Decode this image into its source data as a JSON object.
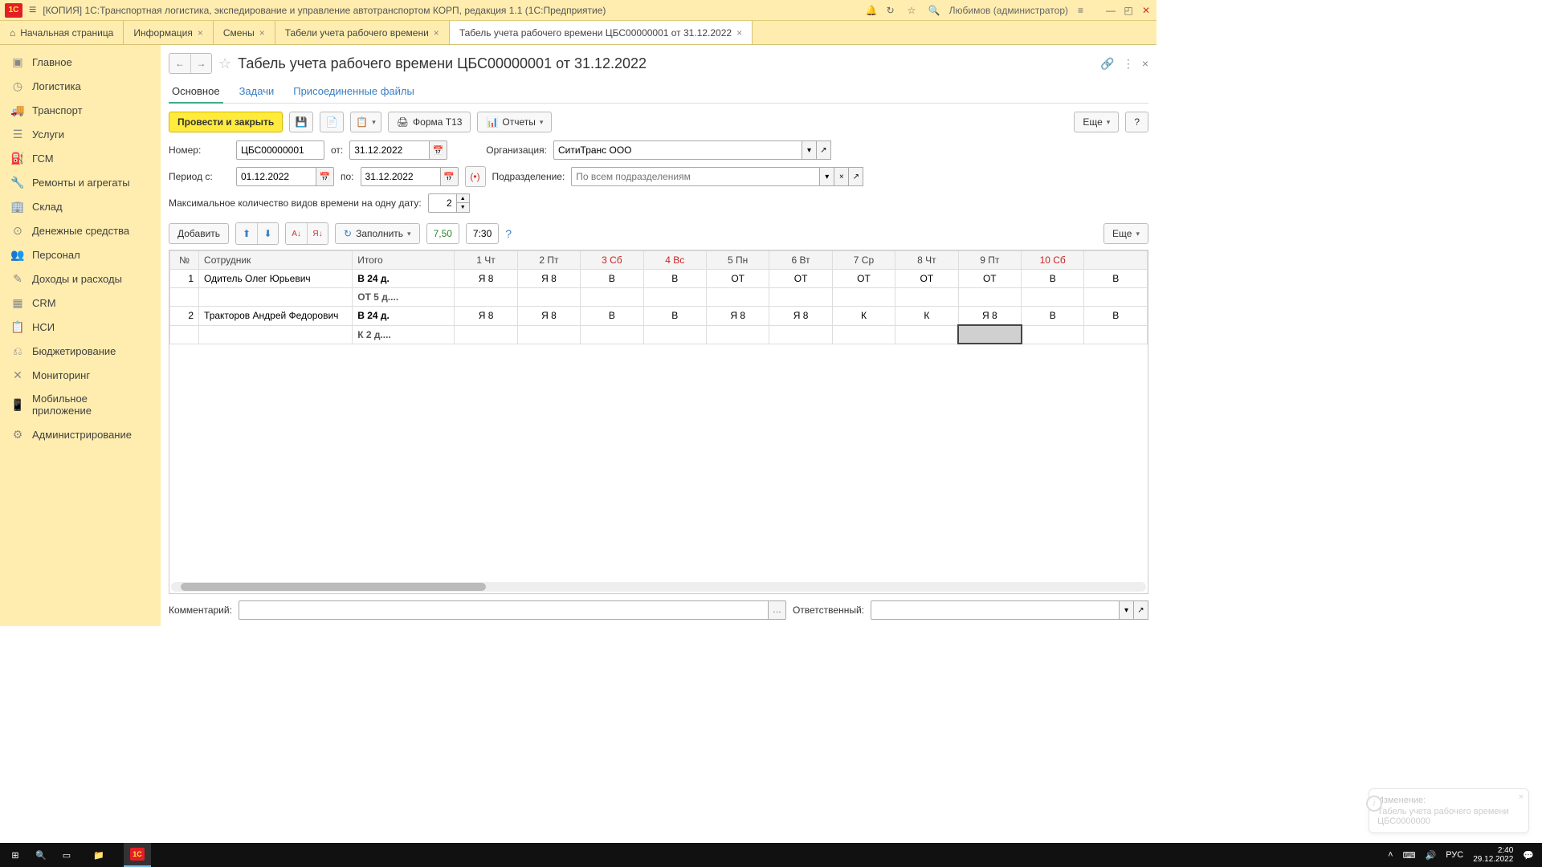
{
  "titlebar": {
    "title": "[КОПИЯ] 1С:Транспортная логистика, экспедирование и управление автотранспортом КОРП, редакция 1.1  (1С:Предприятие)",
    "user": "Любимов (администратор)"
  },
  "tabs": {
    "home": "Начальная страница",
    "items": [
      "Информация",
      "Смены",
      "Табели учета рабочего времени",
      "Табель учета рабочего времени ЦБС00000001 от 31.12.2022"
    ]
  },
  "sidebar": [
    {
      "icon": "▣",
      "label": "Главное"
    },
    {
      "icon": "◷",
      "label": "Логистика"
    },
    {
      "icon": "🚚",
      "label": "Транспорт"
    },
    {
      "icon": "☰",
      "label": "Услуги"
    },
    {
      "icon": "⛽",
      "label": "ГСМ"
    },
    {
      "icon": "🔧",
      "label": "Ремонты и агрегаты"
    },
    {
      "icon": "🏢",
      "label": "Склад"
    },
    {
      "icon": "⊙",
      "label": "Денежные средства"
    },
    {
      "icon": "👥",
      "label": "Персонал"
    },
    {
      "icon": "✎",
      "label": "Доходы и расходы"
    },
    {
      "icon": "▦",
      "label": "CRM"
    },
    {
      "icon": "📋",
      "label": "НСИ"
    },
    {
      "icon": "⎌",
      "label": "Бюджетирование"
    },
    {
      "icon": "✕",
      "label": "Мониторинг"
    },
    {
      "icon": "📱",
      "label": "Мобильное приложение"
    },
    {
      "icon": "⚙",
      "label": "Администрирование"
    }
  ],
  "page": {
    "title": "Табель учета рабочего времени ЦБС00000001 от 31.12.2022",
    "subtabs": {
      "main": "Основное",
      "tasks": "Задачи",
      "files": "Присоединенные файлы"
    }
  },
  "toolbar": {
    "post_close": "Провести и закрыть",
    "form_t13": "Форма Т13",
    "reports": "Отчеты",
    "more": "Еще",
    "help": "?"
  },
  "form": {
    "number_label": "Номер:",
    "number_value": "ЦБС00000001",
    "from_label": "от:",
    "from_value": "31.12.2022",
    "org_label": "Организация:",
    "org_value": "СитиТранс ООО",
    "period_from_label": "Период с:",
    "period_from_value": "01.12.2022",
    "period_to_label": "по:",
    "period_to_value": "31.12.2022",
    "dept_label": "Подразделение:",
    "dept_placeholder": "По всем подразделениям",
    "max_types_label": "Максимальное количество видов времени на одну дату:",
    "max_types_value": "2"
  },
  "table_toolbar": {
    "add": "Добавить",
    "fill": "Заполнить",
    "val1": "7,50",
    "val2": "7:30",
    "more": "Еще"
  },
  "table": {
    "headers": {
      "n": "№",
      "employee": "Сотрудник",
      "total": "Итого",
      "days": [
        {
          "label": "1 Чт",
          "weekend": false
        },
        {
          "label": "2 Пт",
          "weekend": false
        },
        {
          "label": "3 Сб",
          "weekend": true
        },
        {
          "label": "4 Вс",
          "weekend": true
        },
        {
          "label": "5 Пн",
          "weekend": false
        },
        {
          "label": "6 Вт",
          "weekend": false
        },
        {
          "label": "7 Ср",
          "weekend": false
        },
        {
          "label": "8 Чт",
          "weekend": false
        },
        {
          "label": "9 Пт",
          "weekend": false
        },
        {
          "label": "10 Сб",
          "weekend": true
        }
      ]
    },
    "rows": [
      {
        "n": "1",
        "employee": "Одитель Олег Юрьевич",
        "total": "В 24 д.",
        "total2": "ОТ 5 д....",
        "cells": [
          "Я 8",
          "Я 8",
          "В",
          "В",
          "ОТ",
          "ОТ",
          "ОТ",
          "ОТ",
          "ОТ",
          "В",
          "В"
        ]
      },
      {
        "n": "2",
        "employee": "Тракторов Андрей Федорович",
        "total": "В 24 д.",
        "total2": "К 2 д....",
        "cells": [
          "Я 8",
          "Я 8",
          "В",
          "В",
          "Я 8",
          "Я 8",
          "К",
          "К",
          "Я 8",
          "В",
          "В"
        ]
      }
    ]
  },
  "bottom": {
    "comment_label": "Комментарий:",
    "responsible_label": "Ответственный:"
  },
  "notif": {
    "title": "Изменение:",
    "body": "Табель учета рабочего времени ЦБС0000000"
  },
  "taskbar": {
    "lang": "РУС",
    "time": "2:40",
    "date": "29.12.2022"
  }
}
